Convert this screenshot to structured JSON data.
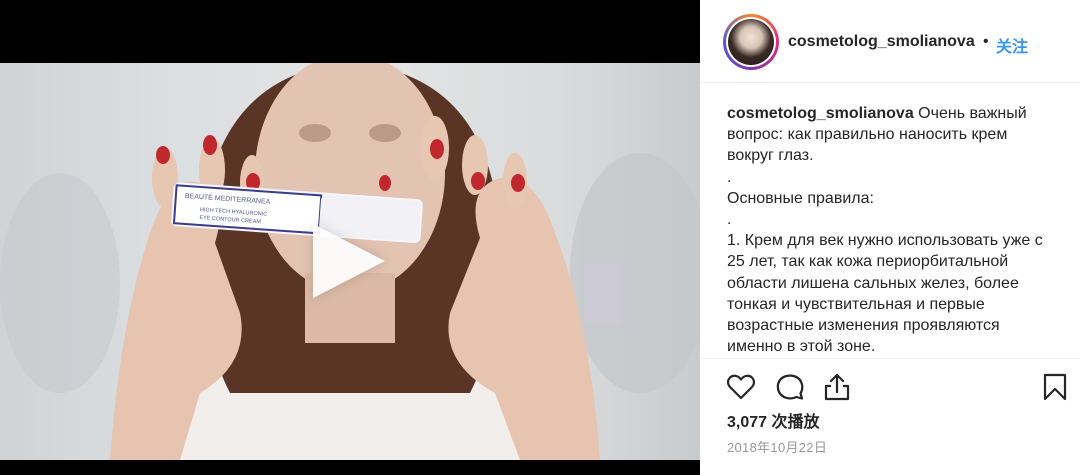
{
  "post": {
    "username": "cosmetolog_smolianova",
    "separator": "•",
    "follow_label": "关注",
    "caption": {
      "username": "cosmetolog_smolianova",
      "lines": [
        "Очень важный вопрос: как правильно наносить крем вокруг глаз.",
        ".",
        "Основные правила:",
        ".",
        "1. Крем для век нужно использовать уже с 25 лет, так как кожа периорбитальной области лишена сальных желез, более тонкая и чувствительная и первые возрастные изменения проявляются именно в этой зоне."
      ]
    },
    "views": "3,077 次播放",
    "date": "2018年10月22日"
  },
  "product": {
    "brand": "BEAUTÉ MEDITERRANEA",
    "line1": "HIGH TECH HYALURONIC",
    "line2": "EYE CONTOUR CREAM"
  },
  "icons": [
    "heart-icon",
    "comment-icon",
    "share-icon",
    "bookmark-icon",
    "play-icon"
  ],
  "colors": {
    "follow": "#3897f0",
    "meta": "#999999",
    "text": "#262626"
  }
}
